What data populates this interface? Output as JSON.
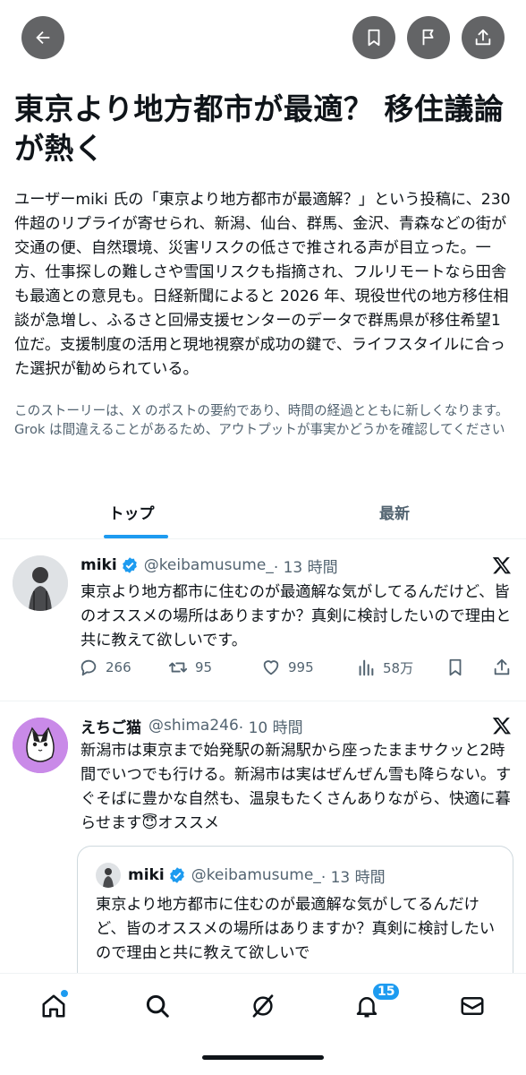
{
  "story": {
    "headline": "東京より地方都市が最適？ 移住議論が熱く",
    "summary": "ユーザーmiki 氏の「東京より地方都市が最適解？」という投稿に、230 件超のリプライが寄せられ、新潟、仙台、群馬、金沢、青森などの街が交通の便、自然環境、災害リスクの低さで推される声が目立った。一方、仕事探しの難しさや雪国リスクも指摘され、フルリモートなら田舎も最適との意見も。日経新聞によると 2026 年、現役世代の地方移住相談が急増し、ふるさと回帰支援センターのデータで群馬県が移住希望1位だ。支援制度の活用と現地視察が成功の鍵で、ライフスタイルに合った選択が勧められている。",
    "disclaimer": "このストーリーは、X のポストの要約であり、時間の経過とともに新しくなります。Grok は間違えることがあるため、アウトプットが事実かどうかを確認してください"
  },
  "tabs": {
    "top": "トップ",
    "latest": "最新"
  },
  "posts": [
    {
      "name": "miki",
      "handle": "@keibamusume_",
      "time": "· 13 時間",
      "text": "東京より地方都市に住むのが最適解な気がしてるんだけど、皆のオススメの場所はありますか？真剣に検討したいので理由と共に教えて欲しいです。",
      "replies": "266",
      "reposts": "95",
      "likes": "995",
      "views": "58万"
    },
    {
      "name": "えちご猫",
      "handle": "@shima246",
      "time": "· 10 時間",
      "text": "新潟市は東京まで始発駅の新潟駅から座ったままサクッと2時間でいつでも行ける。新潟市は実はぜんぜん雪も降らない。すぐそばに豊かな自然も、温泉もたくさんありながら、快適に暮らせます😇オススメ"
    }
  ],
  "quote": {
    "name": "miki",
    "handle": "@keibamusume_",
    "time": "· 13 時間",
    "text": "東京より地方都市に住むのが最適解な気がしてるんだけど、皆のオススメの場所はありますか？真剣に検討したいので理由と共に教えて欲しいで"
  },
  "nav": {
    "notifications_badge": "15"
  },
  "colors": {
    "accent": "#1d9bf0",
    "verified": "#1d9bf0",
    "button_bg": "#636466",
    "secondary_text": "#536471"
  },
  "icons": [
    "back-arrow-icon",
    "bookmark-icon",
    "flag-icon",
    "share-icon",
    "verified-icon",
    "x-logo-icon",
    "reply-icon",
    "repost-icon",
    "like-icon",
    "views-icon",
    "home-icon",
    "search-icon",
    "grok-icon",
    "bell-icon",
    "mail-icon"
  ]
}
